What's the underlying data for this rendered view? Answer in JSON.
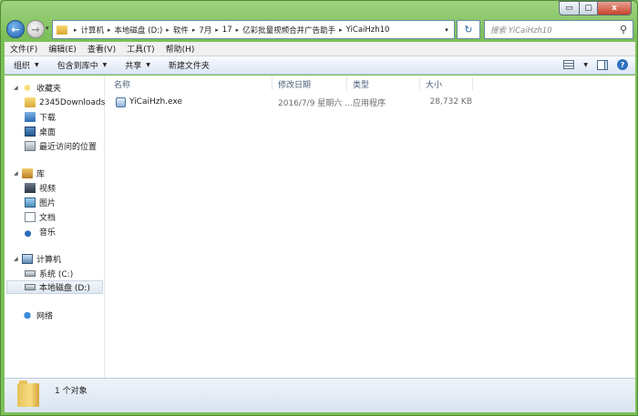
{
  "window": {
    "controls": {
      "minimize": "▭",
      "maximize": "▢",
      "close": "x"
    }
  },
  "nav": {
    "back_glyph": "←",
    "forward_glyph": "→",
    "recent_glyph": "▾",
    "breadcrumb": [
      "计算机",
      "本地磁盘 (D:)",
      "软件",
      "7月",
      "17",
      "亿彩批量视频合并广告助手",
      "YiCaiHzh10"
    ],
    "refresh_glyph": "↻",
    "search_placeholder": "搜索 YiCaiHzh10",
    "search_glyph": "⚲"
  },
  "menu": [
    "文件(F)",
    "编辑(E)",
    "查看(V)",
    "工具(T)",
    "帮助(H)"
  ],
  "toolbar": {
    "organize": "组织",
    "include_library": "包含到库中",
    "share": "共享",
    "new_folder": "新建文件夹",
    "help_glyph": "?"
  },
  "sidebar": {
    "favorites": {
      "label": "收藏夹",
      "items": [
        "2345Downloads",
        "下载",
        "桌面",
        "最近访问的位置"
      ]
    },
    "libraries": {
      "label": "库",
      "items": [
        "视频",
        "图片",
        "文档",
        "音乐"
      ]
    },
    "computer": {
      "label": "计算机",
      "items": [
        "系统 (C:)",
        "本地磁盘 (D:)"
      ]
    },
    "network": {
      "label": "网络"
    }
  },
  "columns": [
    "名称",
    "修改日期",
    "类型",
    "大小"
  ],
  "files": [
    {
      "name": "YiCaiHzh.exe",
      "modified": "2016/7/9 星期六 ...",
      "type": "应用程序",
      "size": "28,732 KB"
    }
  ],
  "status": {
    "count": "1 个对象"
  }
}
